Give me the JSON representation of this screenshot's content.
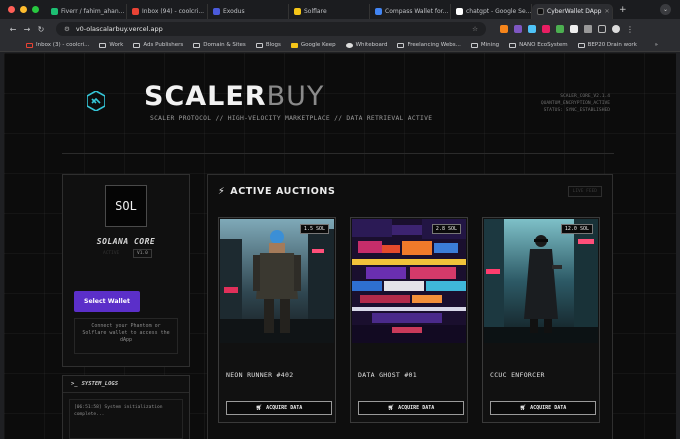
{
  "browser": {
    "tabs": [
      {
        "title": "Fiverr / fahim_ahan...",
        "color": "#1dbf73",
        "active": false
      },
      {
        "title": "Inbox (94) - coolcri...",
        "color": "#ea4335",
        "active": false
      },
      {
        "title": "Exodus",
        "color": "#4b5bdc",
        "active": false
      },
      {
        "title": "Solflare",
        "color": "#f5c518",
        "active": false
      },
      {
        "title": "Compass Wallet for...",
        "color": "#4285f4",
        "active": false
      },
      {
        "title": "chatgpt - Google Se...",
        "color": "#ffffff",
        "active": false
      },
      {
        "title": "CyberWallet DApp",
        "color": "#111111",
        "active": true
      }
    ],
    "url": "v0-olascalarbuy.vercel.app",
    "bookmarks": [
      {
        "label": "Inbox (3) - coolcri...",
        "icon": "gmail-icon"
      },
      {
        "label": "Work",
        "icon": "folder-icon"
      },
      {
        "label": "Ads Publishers",
        "icon": "folder-icon"
      },
      {
        "label": "Domain & Sites",
        "icon": "folder-icon"
      },
      {
        "label": "Blogs",
        "icon": "folder-icon"
      },
      {
        "label": "Google Keep",
        "icon": "keep-icon"
      },
      {
        "label": "Whiteboard",
        "icon": "whiteboard-icon"
      },
      {
        "label": "Freelancing Webs...",
        "icon": "folder-icon"
      },
      {
        "label": "Mining",
        "icon": "folder-icon"
      },
      {
        "label": "NANO EcoSystem",
        "icon": "folder-icon"
      },
      {
        "label": "BEP20 Drain work",
        "icon": "folder-icon"
      }
    ]
  },
  "header": {
    "brand_main": "SCALER",
    "brand_accent": "BUY",
    "tagline": "SCALER PROTOCOL // HIGH-VELOCITY MARKETPLACE // DATA RETRIEVAL ACTIVE",
    "sys_lines": [
      "SCALER_CORE_V2.1.4",
      "QUANTUM_ENCRYPTION_ACTIVE",
      "STATUS: SYNC_ESTABLISHED"
    ]
  },
  "profile": {
    "badge": "SOL",
    "name": "SOLANA CORE",
    "status": "ACTIVE",
    "version": "V1.0",
    "select_label": "Select Wallet",
    "hint": "Connect your Phantom or Solflare wallet to access the dApp"
  },
  "logs": {
    "title": "SYSTEM_LOGS",
    "lines": [
      "[06:51:58] System initialization",
      "complete..."
    ]
  },
  "auctions": {
    "title": "ACTIVE AUCTIONS",
    "badge": "LIVE FEED",
    "cards": [
      {
        "name": "NEON RUNNER #402",
        "price": "1.5 SOL",
        "action": "ACQUIRE DATA"
      },
      {
        "name": "DATA GHOST #01",
        "price": "2.8 SOL",
        "action": "ACQUIRE DATA"
      },
      {
        "name": "CCUC ENFORCER",
        "price": "12.0 SOL",
        "action": "ACQUIRE DATA"
      }
    ]
  },
  "colors": {
    "accent": "#5b2fc9",
    "logo": "#35c6d8",
    "background": "#0c0c0c"
  }
}
